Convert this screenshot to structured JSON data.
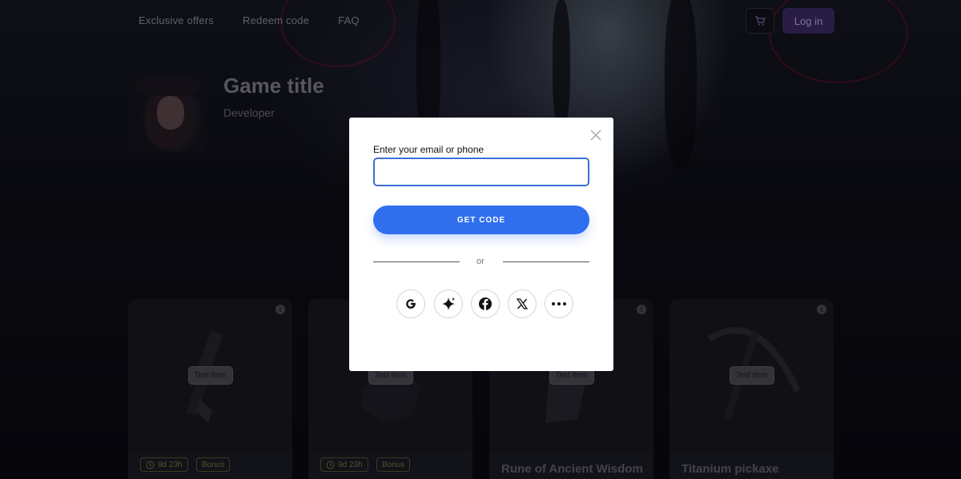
{
  "nav": {
    "links": [
      "Exclusive offers",
      "Redeem code",
      "FAQ"
    ],
    "login_label": "Log in"
  },
  "game": {
    "title": "Game title",
    "developer": "Developer"
  },
  "cards": [
    {
      "tag": "Test item",
      "timer": "9d 23h",
      "bonus": "Bonus"
    },
    {
      "tag": "Test item",
      "timer": "9d 23h",
      "bonus": "Bonus"
    },
    {
      "tag": "Test item",
      "name": "Rune of Ancient Wisdom"
    },
    {
      "tag": "Test item",
      "name": "Titanium pickaxe"
    }
  ],
  "modal": {
    "label": "Enter your email or phone",
    "input_value": "",
    "button_label": "GET CODE",
    "or_text": "or",
    "social_icons": [
      "google-icon",
      "sparkle-icon",
      "facebook-icon",
      "x-icon",
      "more-icon"
    ]
  },
  "colors": {
    "accent": "#2f6fee",
    "login_bg": "#3b2a63",
    "chip": "#6e7a3a"
  }
}
